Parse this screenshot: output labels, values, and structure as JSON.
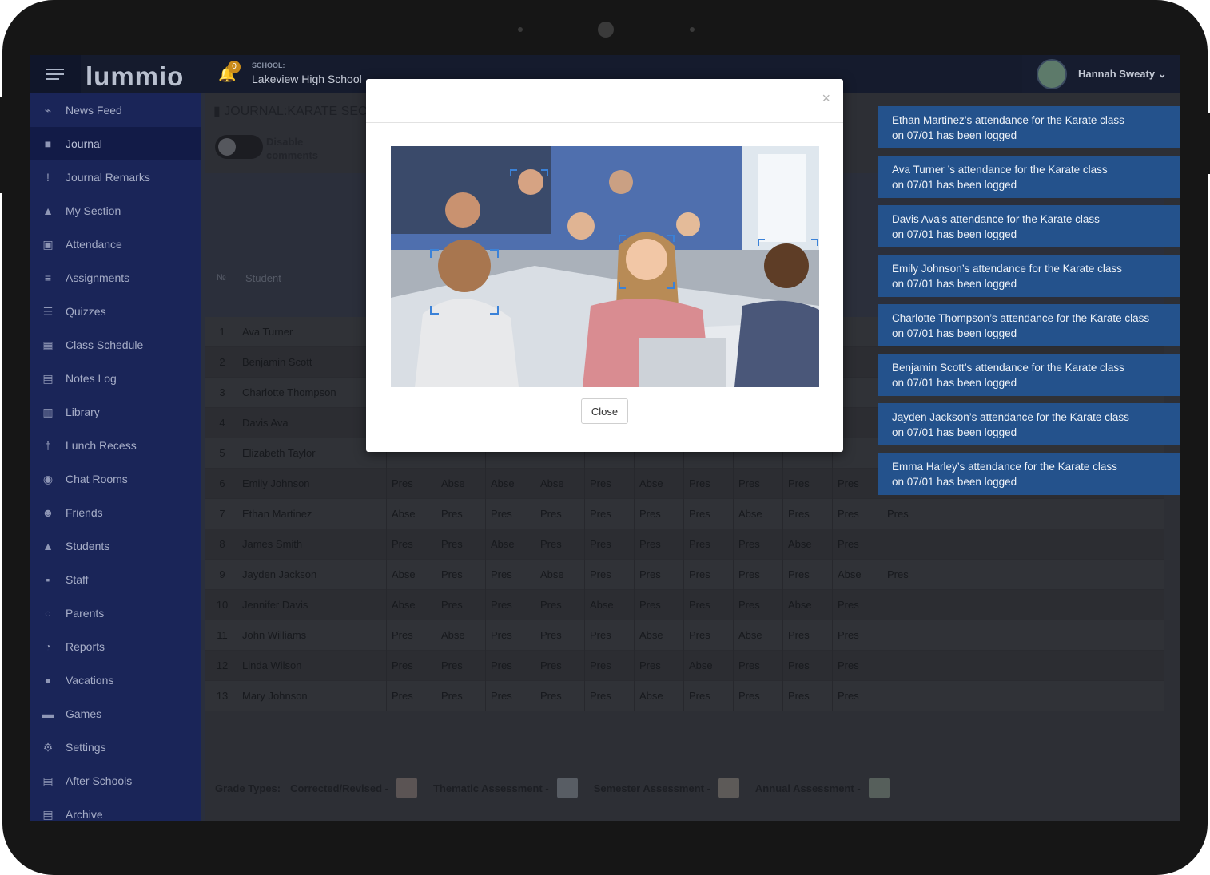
{
  "app": {
    "logo": "lummio",
    "notifications": "0",
    "school_label": "SCHOOL:",
    "school_name": "Lakeview High School",
    "user_name": "Hannah Sweaty"
  },
  "sidebar": [
    {
      "label": "News Feed",
      "icon": "rss-icon",
      "glyph": "⌁"
    },
    {
      "label": "Journal",
      "icon": "bookmark-icon",
      "glyph": "■",
      "active": true
    },
    {
      "label": "Journal Remarks",
      "icon": "exclamation-icon",
      "glyph": "!"
    },
    {
      "label": "My Section",
      "icon": "graduation-cap-icon",
      "glyph": "▲"
    },
    {
      "label": "Attendance",
      "icon": "clipboard-icon",
      "glyph": "▣"
    },
    {
      "label": "Assignments",
      "icon": "list-icon",
      "glyph": "≡"
    },
    {
      "label": "Quizzes",
      "icon": "checklist-icon",
      "glyph": "☰"
    },
    {
      "label": "Class Schedule",
      "icon": "calendar-icon",
      "glyph": "▦"
    },
    {
      "label": "Notes Log",
      "icon": "note-icon",
      "glyph": "▤"
    },
    {
      "label": "Library",
      "icon": "book-icon",
      "glyph": "▥"
    },
    {
      "label": "Lunch Recess",
      "icon": "utensils-icon",
      "glyph": "†"
    },
    {
      "label": "Chat Rooms",
      "icon": "chat-icon",
      "glyph": "◉"
    },
    {
      "label": "Friends",
      "icon": "users-icon",
      "glyph": "☻"
    },
    {
      "label": "Students",
      "icon": "graduation-cap-icon",
      "glyph": "▲"
    },
    {
      "label": "Staff",
      "icon": "badge-icon",
      "glyph": "▪"
    },
    {
      "label": "Parents",
      "icon": "user-circle-icon",
      "glyph": "○"
    },
    {
      "label": "Reports",
      "icon": "pie-chart-icon",
      "glyph": "◔"
    },
    {
      "label": "Vacations",
      "icon": "circle-icon",
      "glyph": "●"
    },
    {
      "label": "Games",
      "icon": "gamepad-icon",
      "glyph": "▬"
    },
    {
      "label": "Settings",
      "icon": "cogs-icon",
      "glyph": "⚙"
    },
    {
      "label": "After Schools",
      "icon": "clipboard-list-icon",
      "glyph": "▤"
    },
    {
      "label": "Archive",
      "icon": "archive-icon",
      "glyph": "▤"
    }
  ],
  "journal": {
    "title": "JOURNAL:KARATE SECT",
    "toggle_label": "Disable comments",
    "col_no": "№",
    "col_student": "Student"
  },
  "students": [
    {
      "n": "1",
      "name": "Ava Turner",
      "att": []
    },
    {
      "n": "2",
      "name": "Benjamin Scott",
      "att": []
    },
    {
      "n": "3",
      "name": "Charlotte Thompson",
      "att": []
    },
    {
      "n": "4",
      "name": "Davis Ava",
      "att": []
    },
    {
      "n": "5",
      "name": "Elizabeth Taylor",
      "att": []
    },
    {
      "n": "6",
      "name": "Emily Johnson",
      "att": [
        "Pres",
        "Abse",
        "Abse",
        "Abse",
        "Pres",
        "Abse",
        "Pres",
        "Pres",
        "Pres",
        "Pres"
      ]
    },
    {
      "n": "7",
      "name": "Ethan Martinez",
      "att": [
        "Abse",
        "Pres",
        "Pres",
        "Pres",
        "Pres",
        "Pres",
        "Pres",
        "Abse",
        "Pres",
        "Pres",
        "Pres"
      ]
    },
    {
      "n": "8",
      "name": "James Smith",
      "att": [
        "Pres",
        "Pres",
        "Abse",
        "Pres",
        "Pres",
        "Pres",
        "Pres",
        "Pres",
        "Abse",
        "Pres"
      ]
    },
    {
      "n": "9",
      "name": "Jayden Jackson",
      "att": [
        "Abse",
        "Pres",
        "Pres",
        "Abse",
        "Pres",
        "Pres",
        "Pres",
        "Pres",
        "Pres",
        "Abse",
        "Pres"
      ]
    },
    {
      "n": "10",
      "name": "Jennifer Davis",
      "att": [
        "Abse",
        "Pres",
        "Pres",
        "Pres",
        "Abse",
        "Pres",
        "Pres",
        "Pres",
        "Abse",
        "Pres"
      ]
    },
    {
      "n": "11",
      "name": "John Williams",
      "att": [
        "Pres",
        "Abse",
        "Pres",
        "Pres",
        "Pres",
        "Abse",
        "Pres",
        "Abse",
        "Pres",
        "Pres"
      ]
    },
    {
      "n": "12",
      "name": "Linda Wilson",
      "att": [
        "Pres",
        "Pres",
        "Pres",
        "Pres",
        "Pres",
        "Pres",
        "Abse",
        "Pres",
        "Pres",
        "Pres"
      ]
    },
    {
      "n": "13",
      "name": "Mary Johnson",
      "att": [
        "Pres",
        "Pres",
        "Pres",
        "Pres",
        "Pres",
        "Abse",
        "Pres",
        "Pres",
        "Pres",
        "Pres"
      ]
    }
  ],
  "grade_types": {
    "label": "Grade Types:",
    "items": [
      {
        "name": "Corrected/Revised -",
        "color": "#e9c4b2"
      },
      {
        "name": "Thematic Assessment -",
        "color": "#dbe8f3"
      },
      {
        "name": "Semester Assessment -",
        "color": "#f1dcc3"
      },
      {
        "name": "Annual Assessment -",
        "color": "#d4efcf"
      }
    ]
  },
  "modal": {
    "close_label": "Close",
    "close_x": "×"
  },
  "toasts": [
    {
      "l1": "Ethan Martinez’s attendance for the Karate class",
      "l2": "on 07/01 has been logged"
    },
    {
      "l1": "Ava Turner ’s attendance for the Karate class",
      "l2": "on 07/01 has been logged"
    },
    {
      "l1": "Davis Ava’s attendance for the Karate class",
      "l2": "on 07/01 has been logged"
    },
    {
      "l1": "Emily Johnson’s attendance for the Karate class",
      "l2": "on 07/01 has been logged"
    },
    {
      "l1": "Charlotte Thompson’s attendance for the Karate class",
      "l2": "on 07/01 has been logged"
    },
    {
      "l1": "Benjamin Scott’s attendance for the Karate class",
      "l2": "on 07/01 has been logged"
    },
    {
      "l1": "Jayden Jackson’s attendance for the Karate class",
      "l2": "on 07/01 has been logged"
    },
    {
      "l1": "Emma Harley’s attendance for the Karate class",
      "l2": "on 07/01 has been logged"
    }
  ]
}
